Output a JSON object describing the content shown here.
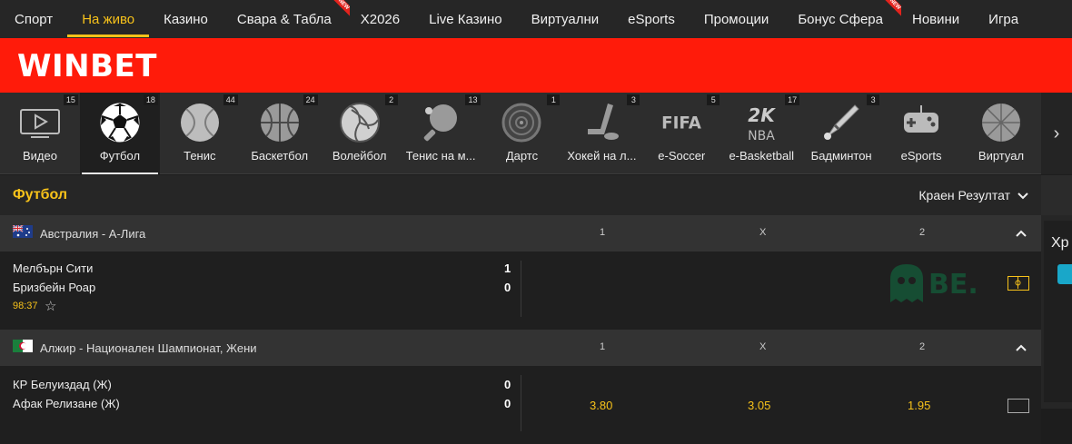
{
  "nav": {
    "items": [
      {
        "label": "Спорт",
        "active": false,
        "new": false
      },
      {
        "label": "На живо",
        "active": true,
        "new": false
      },
      {
        "label": "Казино",
        "active": false,
        "new": false
      },
      {
        "label": "Свара & Табла",
        "active": false,
        "new": true
      },
      {
        "label": "Х2026",
        "active": false,
        "new": false
      },
      {
        "label": "Live Казино",
        "active": false,
        "new": false
      },
      {
        "label": "Виртуални",
        "active": false,
        "new": false
      },
      {
        "label": "eSports",
        "active": false,
        "new": false
      },
      {
        "label": "Промоции",
        "active": false,
        "new": false
      },
      {
        "label": "Бонус Сфера",
        "active": false,
        "new": true
      },
      {
        "label": "Новини",
        "active": false,
        "new": false
      },
      {
        "label": "Игра",
        "active": false,
        "new": false
      }
    ],
    "new_badge": "NEW"
  },
  "brand": {
    "logo": "WINBET"
  },
  "sports": [
    {
      "label": "Видео",
      "count": "15",
      "icon": "video-icon"
    },
    {
      "label": "Футбол",
      "count": "18",
      "icon": "football-icon",
      "active": true
    },
    {
      "label": "Тенис",
      "count": "44",
      "icon": "tennis-icon"
    },
    {
      "label": "Баскетбол",
      "count": "24",
      "icon": "basketball-icon"
    },
    {
      "label": "Волейбол",
      "count": "2",
      "icon": "volleyball-icon"
    },
    {
      "label": "Тенис на м...",
      "count": "13",
      "icon": "table-tennis-icon"
    },
    {
      "label": "Дартс",
      "count": "1",
      "icon": "darts-icon"
    },
    {
      "label": "Хокей на л...",
      "count": "3",
      "icon": "ice-hockey-icon"
    },
    {
      "label": "e-Soccer",
      "count": "5",
      "icon": "fifa-icon"
    },
    {
      "label": "e-Basketball",
      "count": "17",
      "icon": "nba2k-icon"
    },
    {
      "label": "Бадминтон",
      "count": "3",
      "icon": "badminton-icon"
    },
    {
      "label": "eSports",
      "count": "",
      "icon": "gamepad-icon"
    },
    {
      "label": "Виртуал",
      "count": "",
      "icon": "handball-icon"
    }
  ],
  "section": {
    "title": "Футбол",
    "market": "Краен Резултат"
  },
  "odds_headers": [
    "1",
    "X",
    "2"
  ],
  "leagues": [
    {
      "name": "Австралия - А-Лига",
      "flag": "australia-flag-icon",
      "match": {
        "home": "Мелбърн Сити",
        "away": "Бризбейн Роар",
        "home_score": "1",
        "away_score": "0",
        "time": "98:37",
        "odds": [
          "",
          "",
          ""
        ],
        "watermark": "BE."
      }
    },
    {
      "name": "Алжир - Национален Шампионат, Жени",
      "flag": "algeria-flag-icon",
      "match": {
        "home": "КР Белуиздад (Ж)",
        "away": "Афак Релизане (Ж)",
        "home_score": "0",
        "away_score": "0",
        "time": "",
        "odds": [
          "3.80",
          "3.05",
          "1.95"
        ]
      }
    }
  ],
  "right_panel": {
    "heading": "Хр"
  },
  "colors": {
    "accent": "#f7c21a",
    "brand": "#ff1b0a",
    "new": "#e3231d"
  }
}
